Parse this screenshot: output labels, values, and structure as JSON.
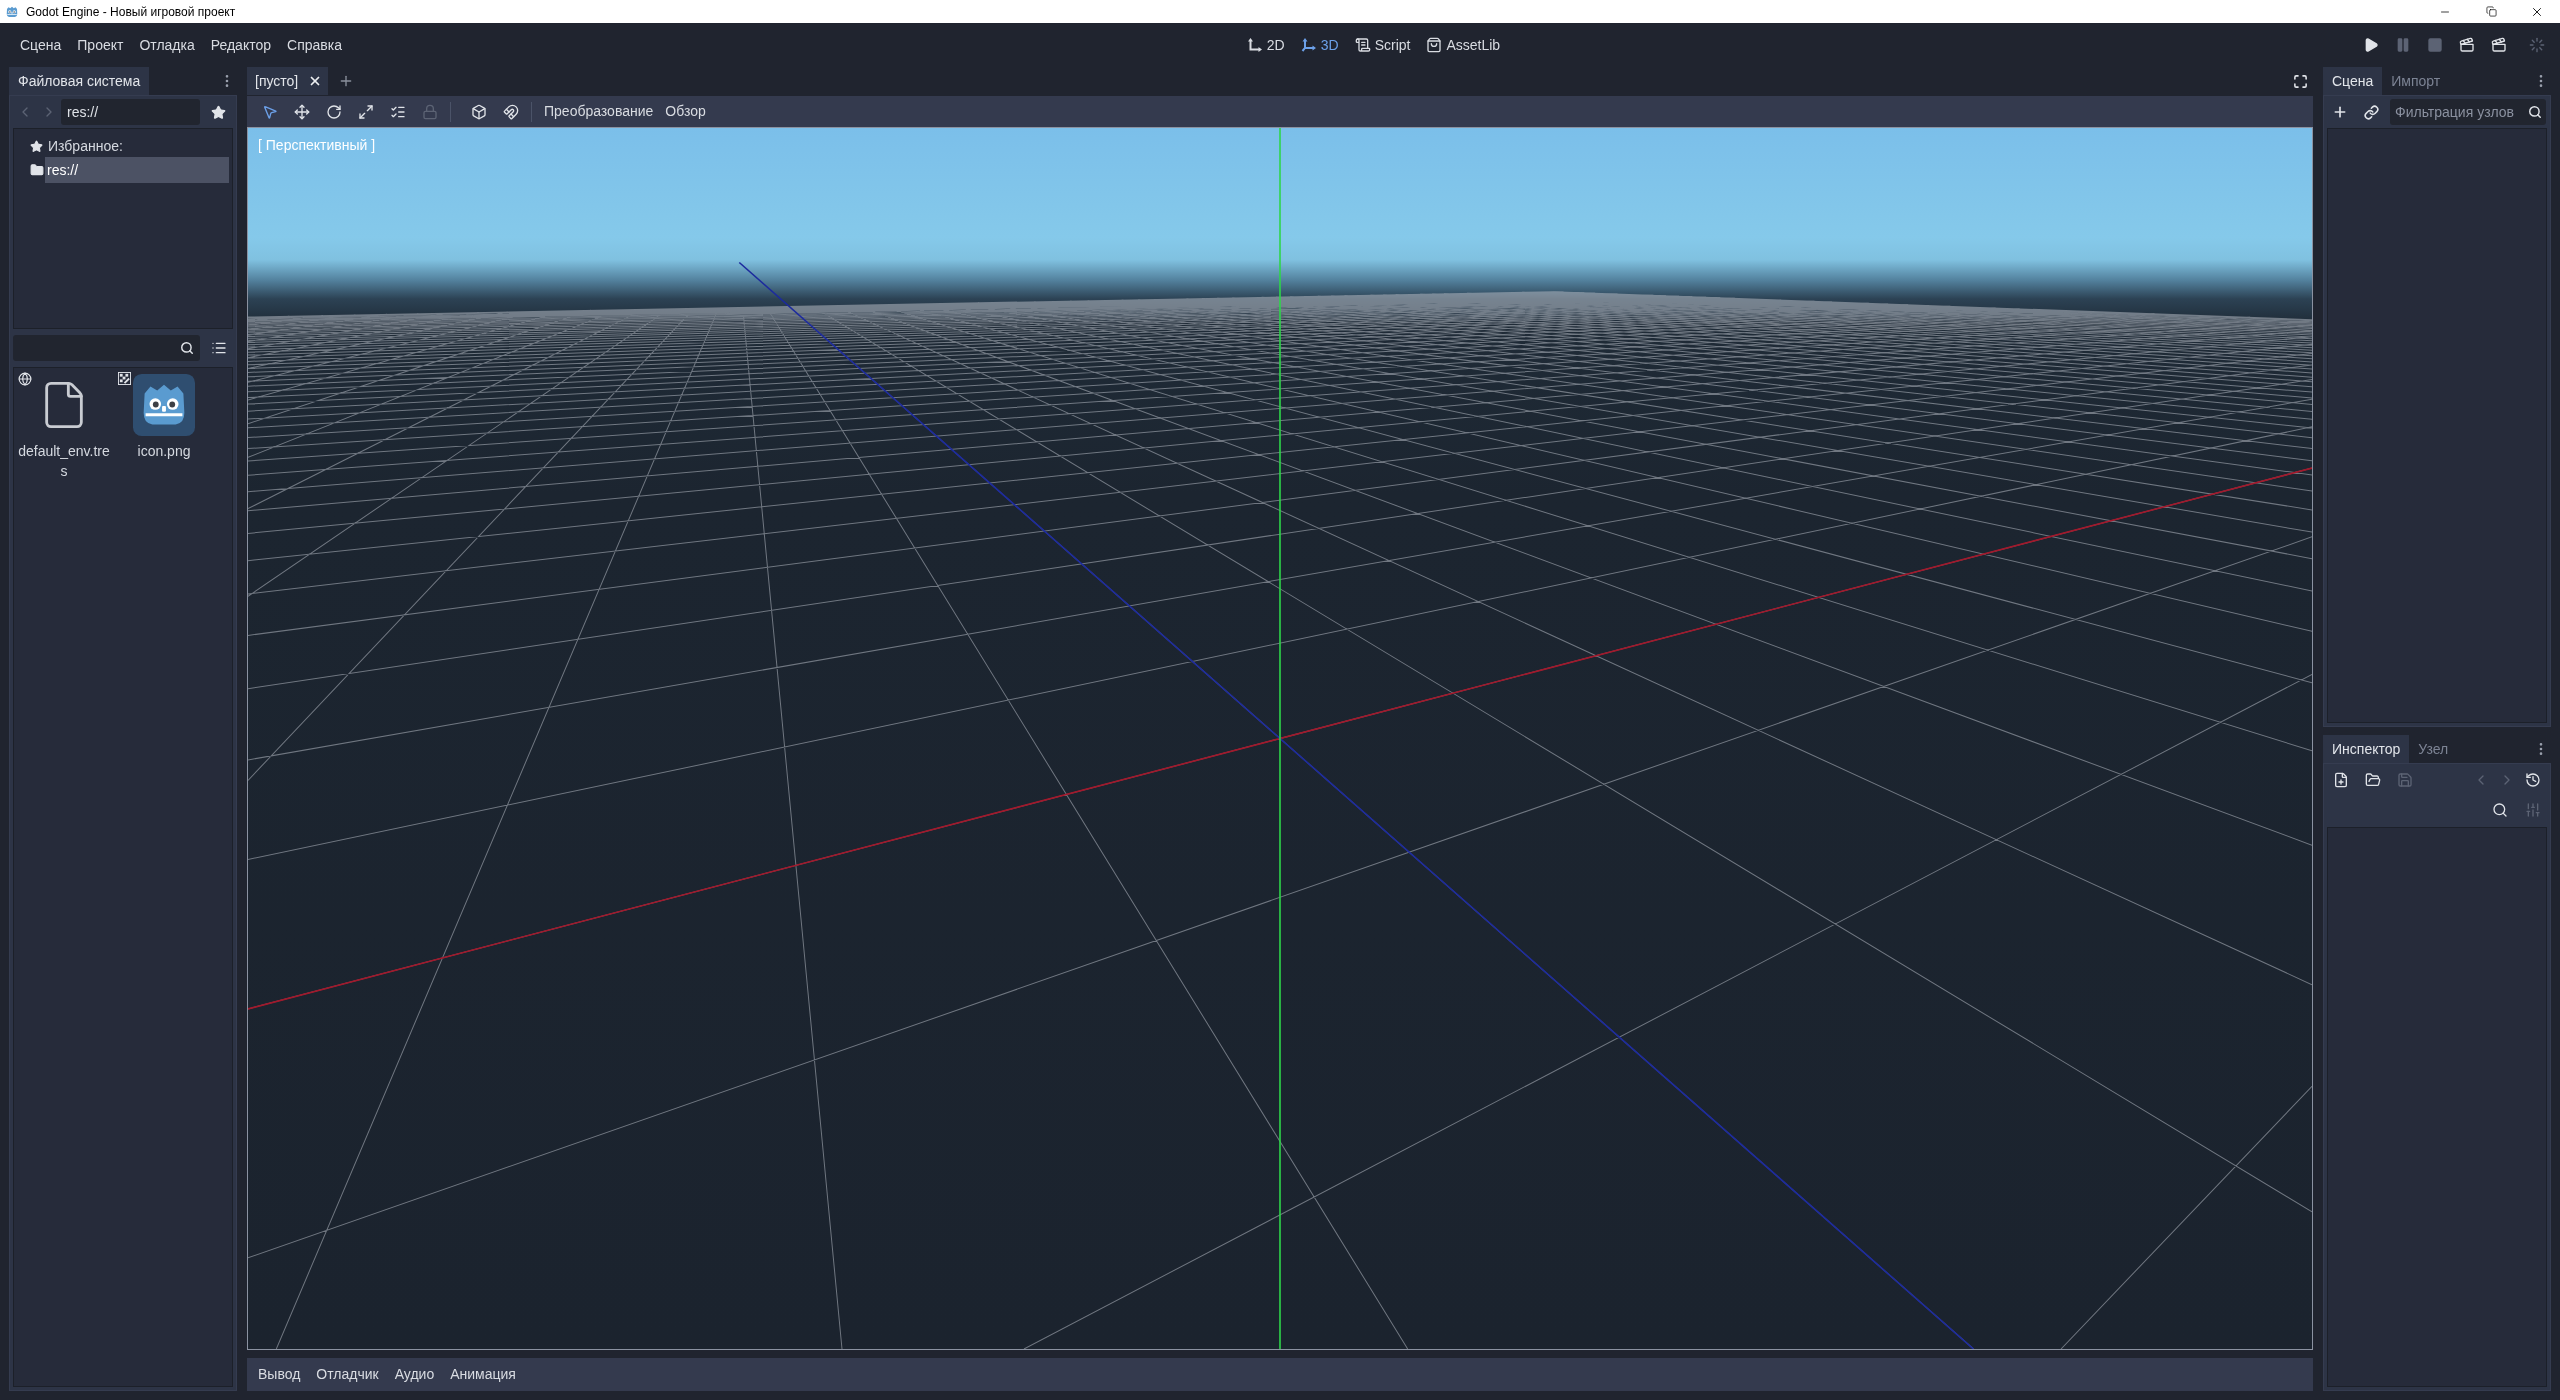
{
  "window": {
    "title": "Godot Engine - Новый игровой проект"
  },
  "menu": [
    "Сцена",
    "Проект",
    "Отладка",
    "Редактор",
    "Справка"
  ],
  "main_screens": [
    {
      "label": "2D",
      "kind": "planar",
      "selected": false
    },
    {
      "label": "3D",
      "kind": "spatial",
      "selected": true
    },
    {
      "label": "Script",
      "kind": "script",
      "selected": false
    },
    {
      "label": "AssetLib",
      "kind": "assetlib",
      "selected": false
    }
  ],
  "run_controls": [
    {
      "kind": "play",
      "disabled": false
    },
    {
      "kind": "pause",
      "disabled": true
    },
    {
      "kind": "stop",
      "disabled": true
    },
    {
      "kind": "play_scene",
      "disabled": false
    },
    {
      "kind": "play_custom",
      "disabled": false
    }
  ],
  "filesystem_dock": {
    "tabs": [
      {
        "label": "Файловая система",
        "selected": true
      }
    ],
    "nav": [
      {
        "kind": "back",
        "disabled": true
      },
      {
        "kind": "forward",
        "disabled": true
      }
    ],
    "path": "res://",
    "favorites": "Избранное:",
    "tree": [
      {
        "label": "res://",
        "selected": true
      }
    ],
    "files": [
      {
        "name": "default_env.tres",
        "kind": "resource"
      },
      {
        "name": "icon.png",
        "kind": "image"
      }
    ]
  },
  "scene_tabs": [
    {
      "label": "[пусто]",
      "selected": true
    }
  ],
  "viewport_toolbar": {
    "tools": [
      {
        "kind": "select",
        "selected": true,
        "disabled": false
      },
      {
        "kind": "move",
        "selected": false,
        "disabled": false
      },
      {
        "kind": "rotate",
        "selected": false,
        "disabled": false
      },
      {
        "kind": "scale",
        "selected": false,
        "disabled": false
      },
      {
        "kind": "list_select",
        "selected": false,
        "disabled": false
      },
      {
        "kind": "lock",
        "selected": false,
        "disabled": true
      },
      {
        "kind": "local_space",
        "selected": false,
        "disabled": false
      },
      {
        "kind": "snap",
        "selected": false,
        "disabled": false
      }
    ],
    "menus": [
      "Преобразование",
      "Обзор"
    ]
  },
  "viewport": {
    "label": "[ Перспективный ]"
  },
  "bottom_panel": [
    "Вывод",
    "Отладчик",
    "Аудио",
    "Анимация"
  ],
  "scene_dock": {
    "tabs": [
      {
        "label": "Сцена",
        "selected": true
      },
      {
        "label": "Импорт",
        "selected": false
      }
    ],
    "filter": {
      "placeholder": "Фильтрация узлов"
    }
  },
  "inspector_dock": {
    "tabs": [
      {
        "label": "Инспектор",
        "selected": true
      },
      {
        "label": "Узел",
        "selected": false
      }
    ],
    "resource_tools": [
      {
        "kind": "new",
        "disabled": false
      },
      {
        "kind": "open",
        "disabled": false
      },
      {
        "kind": "save",
        "disabled": true
      }
    ],
    "history_tools": [
      {
        "kind": "back",
        "disabled": true
      },
      {
        "kind": "forward",
        "disabled": true
      },
      {
        "kind": "history",
        "disabled": false
      }
    ],
    "search_tools": [
      {
        "kind": "search",
        "disabled": false
      },
      {
        "kind": "filter",
        "disabled": true
      }
    ]
  }
}
